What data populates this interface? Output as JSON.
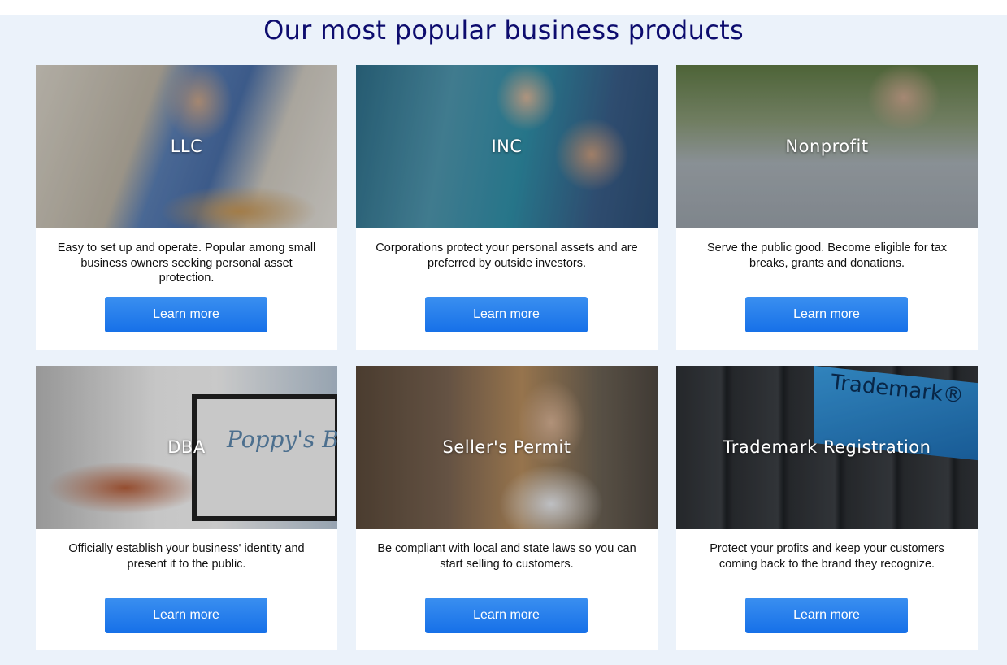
{
  "heading": "Our most popular business products",
  "cards": [
    {
      "title": "LLC",
      "description": "Easy to set up and operate. Popular among small business owners seeking personal asset protection.",
      "button": "Learn more"
    },
    {
      "title": "INC",
      "description": "Corporations protect your personal assets and are preferred by outside investors.",
      "button": "Learn more"
    },
    {
      "title": "Nonprofit",
      "description": "Serve the public good. Become eligible for tax breaks, grants and donations.",
      "button": "Learn more"
    },
    {
      "title": "DBA",
      "description": "Officially establish your business' identity and present it to the public.",
      "button": "Learn more"
    },
    {
      "title": "Seller's Permit",
      "description": "Be compliant with local and state laws so you can start selling to customers.",
      "button": "Learn more"
    },
    {
      "title": "Trademark Registration",
      "description": "Protect your profits and keep your customers coming back to the brand they recognize.",
      "button": "Learn more"
    }
  ],
  "photo_text": {
    "poppys_sign": "Poppy's Bakery",
    "trademark_key": "Trademark®"
  },
  "colors": {
    "heading": "#0d0c6e",
    "section_background": "#ebf2fa",
    "button": "#1a73e8"
  }
}
